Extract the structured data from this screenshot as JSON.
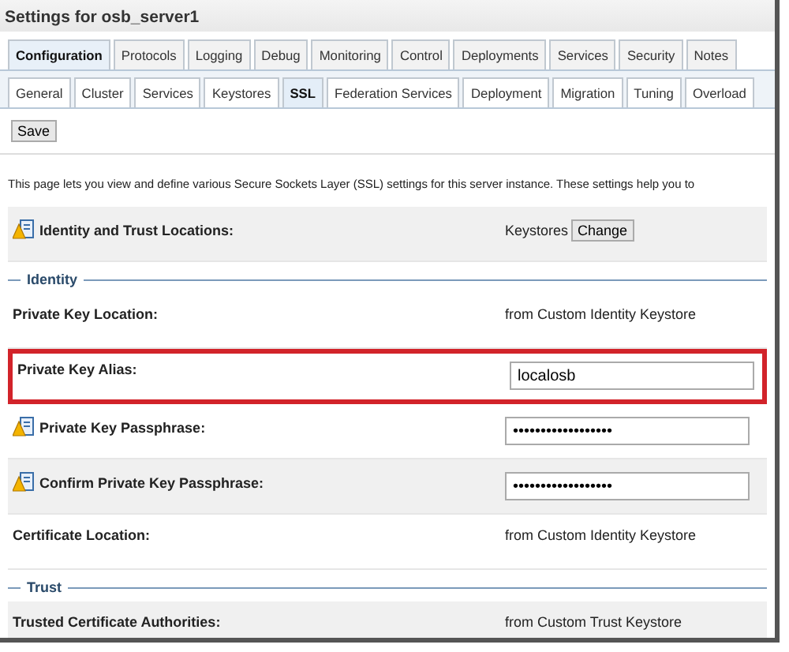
{
  "title": "Settings for osb_server1",
  "tabs": [
    {
      "label": "Configuration",
      "selected": true
    },
    {
      "label": "Protocols",
      "selected": false
    },
    {
      "label": "Logging",
      "selected": false
    },
    {
      "label": "Debug",
      "selected": false
    },
    {
      "label": "Monitoring",
      "selected": false
    },
    {
      "label": "Control",
      "selected": false
    },
    {
      "label": "Deployments",
      "selected": false
    },
    {
      "label": "Services",
      "selected": false
    },
    {
      "label": "Security",
      "selected": false
    },
    {
      "label": "Notes",
      "selected": false
    }
  ],
  "subtabs": [
    {
      "label": "General",
      "selected": false
    },
    {
      "label": "Cluster",
      "selected": false
    },
    {
      "label": "Services",
      "selected": false
    },
    {
      "label": "Keystores",
      "selected": false
    },
    {
      "label": "SSL",
      "selected": true
    },
    {
      "label": "Federation Services",
      "selected": false
    },
    {
      "label": "Deployment",
      "selected": false
    },
    {
      "label": "Migration",
      "selected": false
    },
    {
      "label": "Tuning",
      "selected": false
    },
    {
      "label": "Overload",
      "selected": false
    }
  ],
  "save_button": "Save",
  "description": "This page lets you view and define various Secure Sockets Layer (SSL) settings for this server instance. These settings help you to",
  "sections": [
    {
      "kind": "rows",
      "rows": [
        {
          "label": "Identity and Trust Locations:",
          "kind": "button",
          "value": "Keystores",
          "button": "Change",
          "warning_icon": true,
          "shaded": true,
          "highlighted": false
        }
      ]
    },
    {
      "kind": "group",
      "legend": "Identity",
      "rows": [
        {
          "label": "Private Key Location:",
          "kind": "text",
          "value": "from Custom Identity Keystore",
          "warning_icon": false,
          "shaded": false,
          "highlighted": false
        },
        {
          "label": "Private Key Alias:",
          "kind": "input",
          "value": "localosb",
          "warning_icon": false,
          "shaded": false,
          "highlighted": true
        },
        {
          "label": "Private Key Passphrase:",
          "kind": "password",
          "value": "••••••••••••••••••",
          "warning_icon": true,
          "shaded": false,
          "highlighted": false
        },
        {
          "label": "Confirm Private Key Passphrase:",
          "kind": "password",
          "value": "••••••••••••••••••",
          "warning_icon": true,
          "shaded": true,
          "highlighted": false
        },
        {
          "label": "Certificate Location:",
          "kind": "text",
          "value": "from Custom Identity Keystore",
          "warning_icon": false,
          "shaded": false,
          "highlighted": false
        }
      ]
    },
    {
      "kind": "group",
      "legend": "Trust",
      "rows": [
        {
          "label": "Trusted Certificate Authorities:",
          "kind": "text",
          "value": "from Custom Trust Keystore",
          "warning_icon": false,
          "shaded": true,
          "highlighted": false
        }
      ]
    }
  ]
}
